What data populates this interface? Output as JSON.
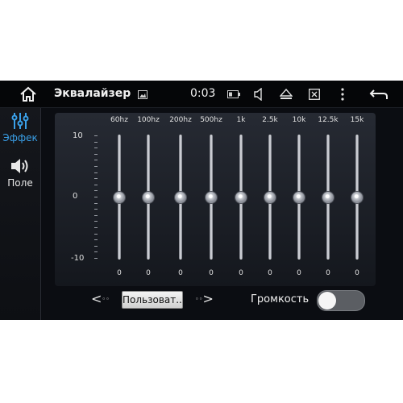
{
  "status_bar": {
    "title": "Эквалайзер",
    "time": "0:03",
    "icons": [
      "home-icon",
      "picture-icon",
      "battery-icon",
      "volume-icon",
      "eject-icon",
      "close-window-icon",
      "more-icon",
      "back-icon"
    ]
  },
  "sidebar": {
    "items": [
      {
        "label": "Эффек",
        "icon": "equalizer-sliders-icon",
        "active": true,
        "color": "#3aa0e8"
      },
      {
        "label": "Поле",
        "icon": "speaker-icon",
        "active": false,
        "color": "#e8e8e8"
      }
    ]
  },
  "equalizer": {
    "scale": {
      "top": "10",
      "mid": "0",
      "bottom": "-10"
    },
    "bands": [
      {
        "freq": "60hz",
        "value": 0,
        "label": "0"
      },
      {
        "freq": "100hz",
        "value": 0,
        "label": "0"
      },
      {
        "freq": "200hz",
        "value": 0,
        "label": "0"
      },
      {
        "freq": "500hz",
        "value": 0,
        "label": "0"
      },
      {
        "freq": "1k",
        "value": 0,
        "label": "0"
      },
      {
        "freq": "2.5k",
        "value": 0,
        "label": "0"
      },
      {
        "freq": "10k",
        "value": 0,
        "label": "0"
      },
      {
        "freq": "12.5k",
        "value": 0,
        "label": "0"
      },
      {
        "freq": "15k",
        "value": 0,
        "label": "0"
      }
    ]
  },
  "controls": {
    "preset_label": "Пользоват...",
    "loudness_label": "Громкость",
    "loudness_on": false
  }
}
